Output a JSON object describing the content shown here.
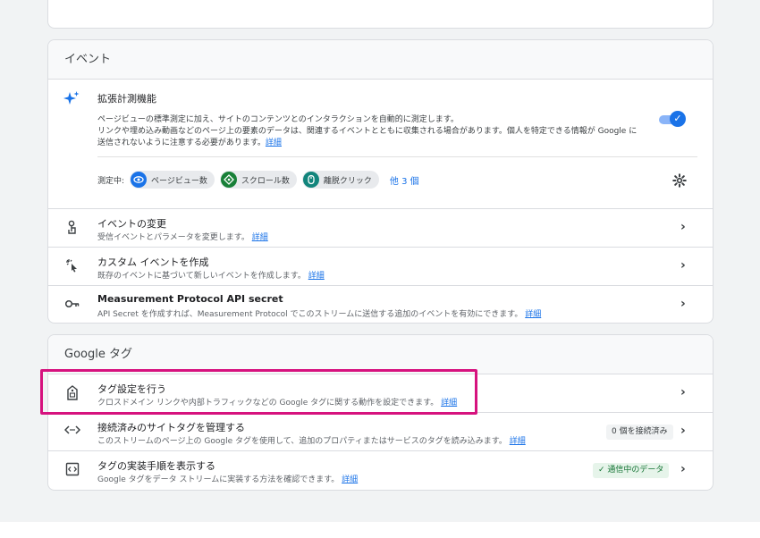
{
  "events_card": {
    "title": "イベント",
    "enhanced": {
      "title": "拡張計測機能",
      "desc1": "ページビューの標準測定に加え、サイトのコンテンツとのインタラクションを自動的に測定します。",
      "desc2": "リンクや埋め込み動画などのページ上の要素のデータは、関連するイベントとともに収集される場合があります。個人を特定できる情報が Google に",
      "desc3": "送信されないように注意する必要があります。",
      "detail_link": "詳細",
      "toggle_on": true,
      "measuring_label": "測定中:",
      "chips": [
        {
          "label": "ページビュー数",
          "icon": "eye-icon",
          "color": "#1a73e8"
        },
        {
          "label": "スクロール数",
          "icon": "scroll-icon",
          "color": "#188038"
        },
        {
          "label": "離脱クリック",
          "icon": "mouse-icon",
          "color": "#12857c"
        }
      ],
      "more": "他 3 個"
    },
    "rows": [
      {
        "title": "イベントの変更",
        "desc": "受信イベントとパラメータを変更します。",
        "link": "詳細",
        "icon": "touch-icon"
      },
      {
        "title": "カスタム イベントを作成",
        "desc": "既存のイベントに基づいて新しいイベントを作成します。",
        "link": "詳細",
        "icon": "cursor-click-icon"
      },
      {
        "title": "Measurement Protocol API secret",
        "desc": "API Secret を作成すれば、Measurement Protocol でこのストリームに送信する追加のイベントを有効にできます。",
        "link": "詳細",
        "icon": "key-icon"
      }
    ]
  },
  "gtag_card": {
    "title": "Google タグ",
    "rows": [
      {
        "title": "タグ設定を行う",
        "desc": "クロスドメイン リンクや内部トラフィックなどの Google タグに関する動作を設定できます。",
        "link": "詳細",
        "icon": "tag-icon"
      },
      {
        "title": "接続済みのサイトタグを管理する",
        "desc": "このストリームのページ上の Google タグを使用して、追加のプロパティまたはサービスのタグを読み込みます。",
        "link": "詳細",
        "icon": "code-icon",
        "badge": "0 個を接続済み"
      },
      {
        "title": "タグの実装手順を表示する",
        "desc": "Google タグをデータ ストリームに実装する方法を確認できます。",
        "link": "詳細",
        "icon": "code-box-icon",
        "badge": "通信中のデータ",
        "badge_check": "✓"
      }
    ]
  },
  "colors": {
    "accent": "#1a73e8",
    "highlight": "#d6127e"
  }
}
